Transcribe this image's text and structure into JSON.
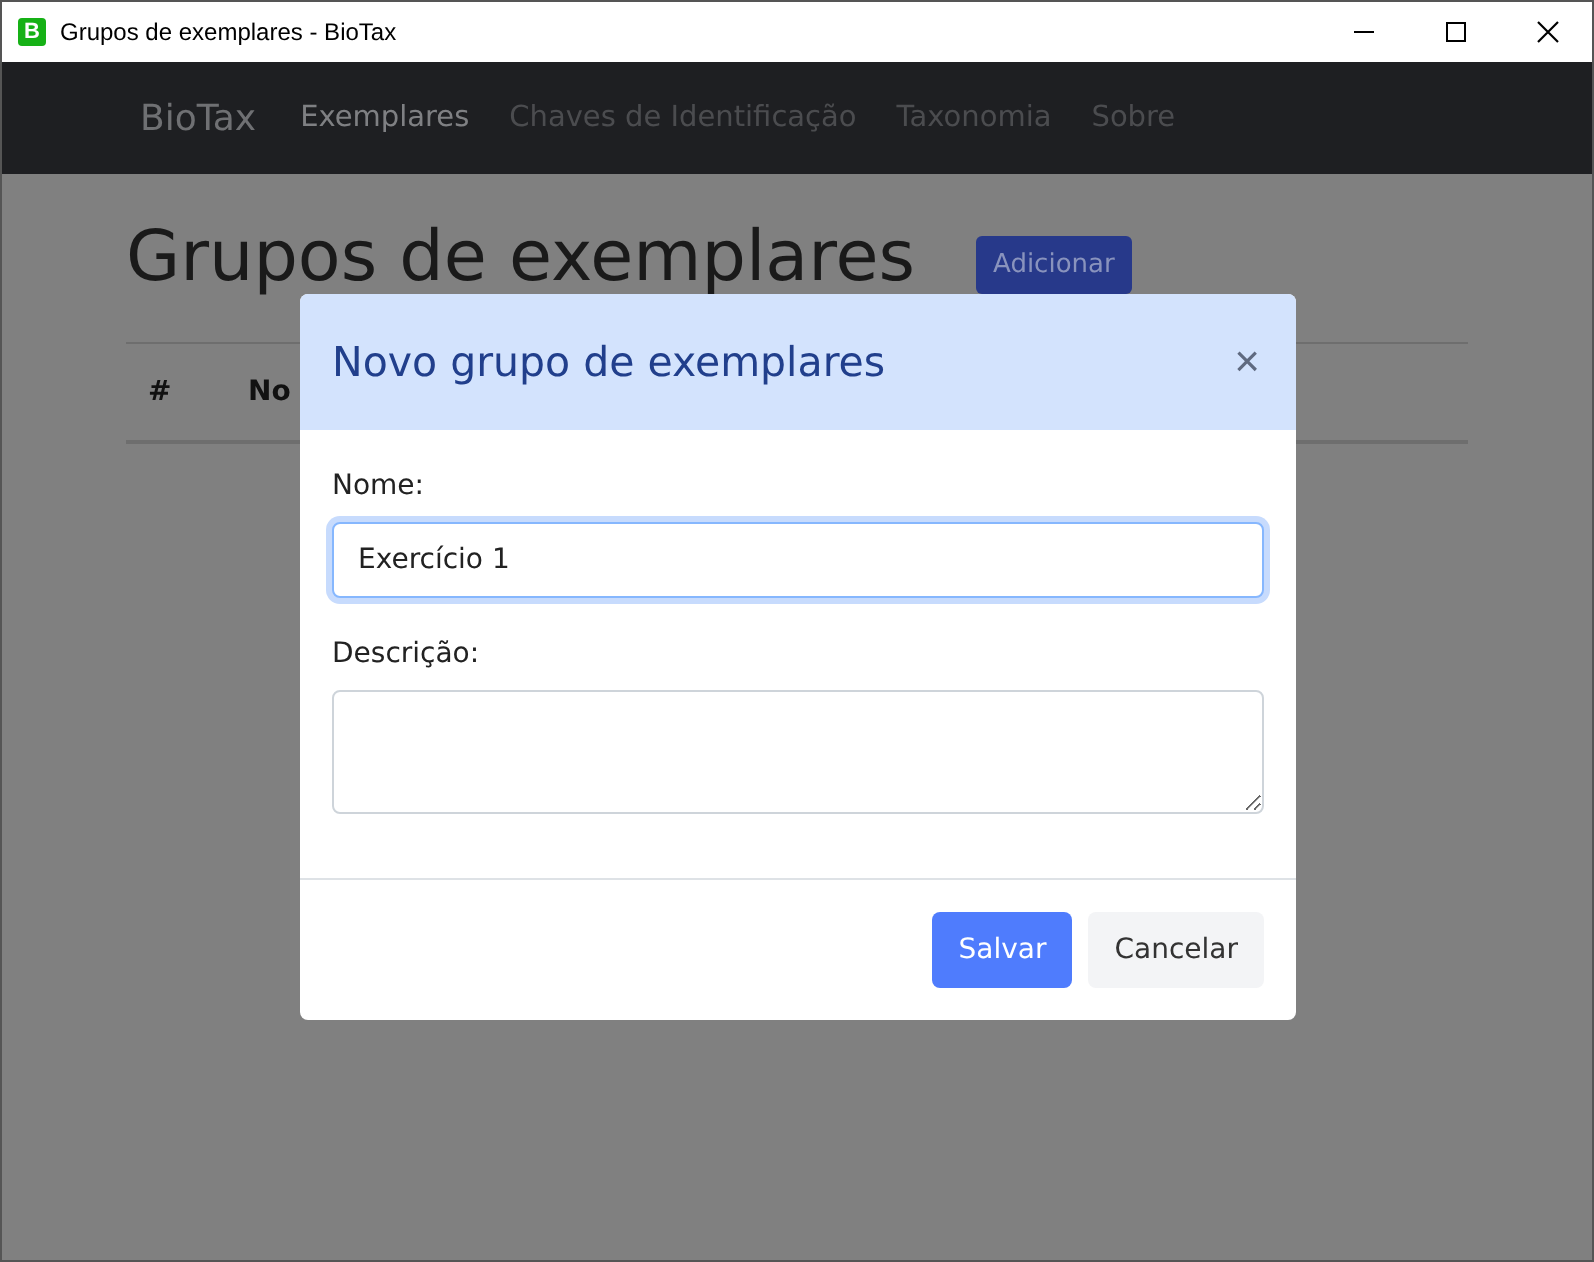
{
  "window": {
    "title": "Grupos de exemplares - BioTax",
    "app_icon_letter": "B"
  },
  "navbar": {
    "brand": "BioTax",
    "items": [
      {
        "label": "Exemplares",
        "selected": true
      },
      {
        "label": "Chaves de Identificação",
        "selected": false
      },
      {
        "label": "Taxonomia",
        "selected": false
      },
      {
        "label": "Sobre",
        "selected": false
      }
    ]
  },
  "page": {
    "heading": "Grupos de exemplares",
    "add_button": "Adicionar",
    "table": {
      "columns": [
        "#",
        "No"
      ]
    }
  },
  "modal": {
    "title": "Novo grupo de exemplares",
    "close": "×",
    "fields": [
      {
        "label": "Nome:",
        "kind": "input",
        "value": "Exercício 1",
        "focused": true
      },
      {
        "label": "Descrição:",
        "kind": "textarea",
        "focused": false
      }
    ],
    "buttons": [
      {
        "label": "Salvar",
        "kind": "primary"
      },
      {
        "label": "Cancelar",
        "kind": "secondary"
      }
    ]
  }
}
